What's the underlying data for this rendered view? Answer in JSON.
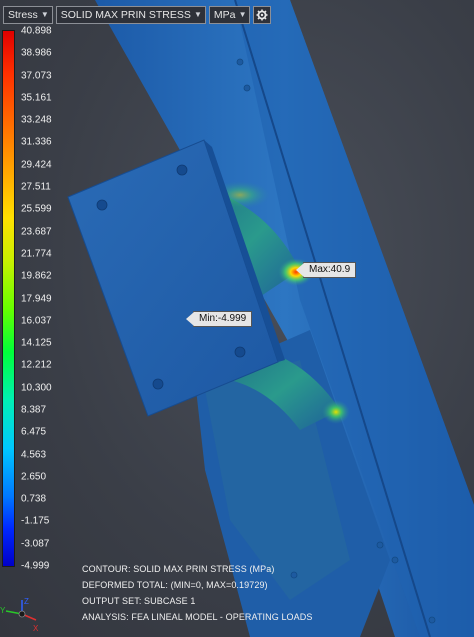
{
  "toolbar": {
    "result_type": "Stress",
    "component": "SOLID MAX PRIN STRESS",
    "units": "MPa",
    "settings_icon": "gear-icon"
  },
  "legend": {
    "labels": [
      "40.898",
      "38.986",
      "37.073",
      "35.161",
      "33.248",
      "31.336",
      "29.424",
      "27.511",
      "25.599",
      "23.687",
      "21.774",
      "19.862",
      "17.949",
      "16.037",
      "14.125",
      "12.212",
      "10.300",
      "8.387",
      "6.475",
      "4.563",
      "2.650",
      "0.738",
      "-1.175",
      "-3.087",
      "-4.999"
    ],
    "top_color": "#e00000",
    "bottom_color": "#0000c8"
  },
  "callouts": {
    "max": "Max:40.9",
    "min": "Min:-4.999"
  },
  "info": {
    "contour": "CONTOUR: SOLID MAX PRIN STRESS (MPa)",
    "deformed": "DEFORMED TOTAL: (MIN=0, MAX=0.19729)",
    "output_set": "OUTPUT SET: SUBCASE 1",
    "analysis": "ANALYSIS: FEA LINEAL MODEL - OPERATING LOADS"
  },
  "triad": {
    "x_label": "X",
    "y_label": "Y",
    "z_label": "Z"
  }
}
